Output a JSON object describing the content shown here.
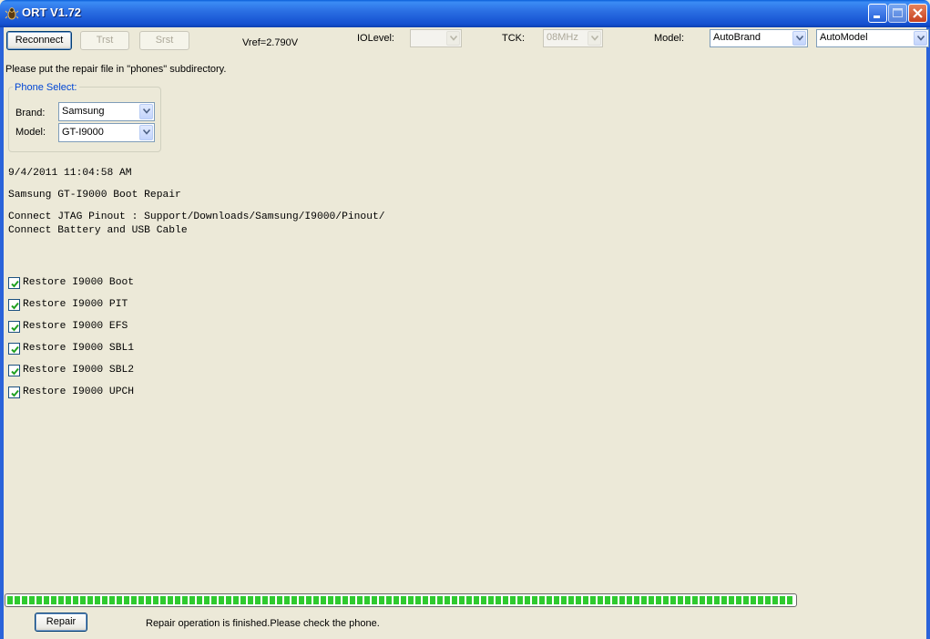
{
  "window": {
    "title": "ORT V1.72"
  },
  "toolbar": {
    "reconnect_label": "Reconnect",
    "trst_label": "Trst",
    "srst_label": "Srst",
    "vref_text": "Vref=2.790V",
    "iolevel_label": "IOLevel:",
    "iolevel_value": "",
    "tck_label": "TCK:",
    "tck_value": "08MHz",
    "model_label": "Model:",
    "brand_select_value": "AutoBrand",
    "model_select_value": "AutoModel"
  },
  "info_text": "Please put the repair file in \"phones\" subdirectory.",
  "phone_select": {
    "title": "Phone Select:",
    "brand_label": "Brand:",
    "brand_value": "Samsung",
    "model_label": "Model:",
    "model_value": "GT-I9000"
  },
  "log": {
    "timestamp": "9/4/2011 11:04:58 AM",
    "operation": "Samsung GT-I9000 Boot Repair",
    "instruction_1": "Connect JTAG Pinout : Support/Downloads/Samsung/I9000/Pinout/",
    "instruction_2": "Connect Battery and USB Cable"
  },
  "restore_options": [
    {
      "label": "Restore I9000 Boot",
      "checked": true
    },
    {
      "label": "Restore I9000 PIT",
      "checked": true
    },
    {
      "label": "Restore I9000 EFS",
      "checked": true
    },
    {
      "label": "Restore I9000 SBL1",
      "checked": true
    },
    {
      "label": "Restore I9000 SBL2",
      "checked": true
    },
    {
      "label": "Restore I9000 UPCH",
      "checked": true
    }
  ],
  "progress": {
    "percent": 100,
    "color": "#2fca2f"
  },
  "footer": {
    "repair_label": "Repair",
    "status_text": "Repair operation is finished.Please check the phone."
  },
  "icons": {
    "app": "bug-icon",
    "minimize": "minimize-icon",
    "maximize": "maximize-icon",
    "close": "close-icon",
    "dropdown": "chevron-down-icon",
    "check": "check-icon"
  }
}
